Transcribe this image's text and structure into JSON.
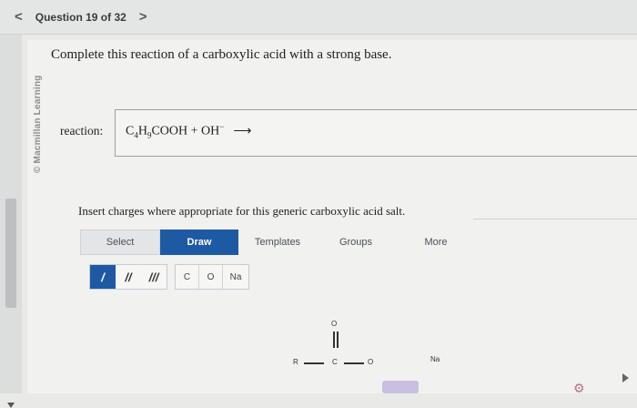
{
  "header": {
    "prev": "<",
    "question_number": "Question 19 of 32",
    "next": ">"
  },
  "watermark": "© Macmillan Learning",
  "question_text": "Complete this reaction of a carboxylic acid with a strong base.",
  "reaction": {
    "label": "reaction:",
    "reactant_c": "C",
    "sub1": "4",
    "h": "H",
    "sub2": "9",
    "cooh": "COOH + OH",
    "sup": "−",
    "arrow": "⟶"
  },
  "instruction": "Insert charges where appropriate for this generic carboxylic acid salt.",
  "tabs": [
    "Select",
    "Draw",
    "Templates",
    "Groups",
    "More"
  ],
  "bond_tools": [
    "/",
    "//",
    "///"
  ],
  "atom_tools": [
    "C",
    "O",
    "Na"
  ],
  "canvas": {
    "o_top": "O",
    "r": "R",
    "c": "C",
    "o_right": "O",
    "na": "Na"
  },
  "colors": {
    "accent": "#1e5aa3"
  }
}
